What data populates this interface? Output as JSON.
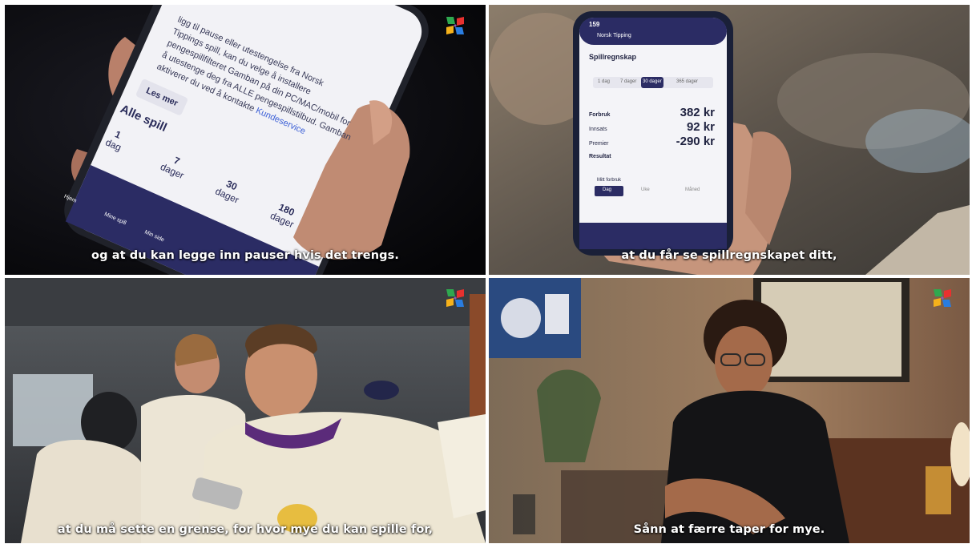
{
  "panels": [
    {
      "subtitle": "og at du kan legge inn pauser hvis det trengs.",
      "phone": {
        "body_text_lines": [
          "ligg til pause eller utestengelse fra Norsk",
          "Tippings spill, kan du velge å installere",
          "pengespillfilteret Gamban på din PC/MAC/mobil for",
          "å utestenge deg fra ALLE pengespillstilbud. Gamban",
          "aktiverer du ved å kontakte"
        ],
        "link_text": "Kundeservice",
        "button_label": "Les mer",
        "section_title": "Alle spill",
        "periods": [
          {
            "value": "1",
            "unit": "dag"
          },
          {
            "value": "7",
            "unit": "dager"
          },
          {
            "value": "30",
            "unit": "dager"
          },
          {
            "value": "180",
            "unit": "dager"
          }
        ],
        "nav_items": [
          "Hjem",
          "Mine spill",
          "Min side"
        ]
      }
    },
    {
      "subtitle": "at du får se spillregnskapet ditt,",
      "phone": {
        "status_time": "159",
        "app_title": "Norsk Tipping",
        "heading": "Spillregnskap",
        "tabs": [
          "1 dag",
          "7 dager",
          "30 dager",
          "365 dager"
        ],
        "rows": [
          {
            "label": "Forbruk",
            "value": "382 kr"
          },
          {
            "label": "Innsats",
            "value": "92 kr"
          },
          {
            "label": "Premier",
            "value": "-290 kr"
          },
          {
            "label": "Resultat",
            "value": ""
          }
        ],
        "limit_label": "Mitt forbruk",
        "limit_tabs": [
          "Dag",
          "Uke",
          "Måned"
        ]
      }
    },
    {
      "subtitle": "at du må sette en grense, for hvor mye du kan spille for,"
    },
    {
      "subtitle": "Sånn at færre taper for mye."
    }
  ],
  "logo": {
    "name": "norsk-tipping-logo",
    "colors": [
      "#e8312f",
      "#f6b21b",
      "#2fa84f",
      "#2a7de1",
      "#8b5ab5"
    ]
  }
}
